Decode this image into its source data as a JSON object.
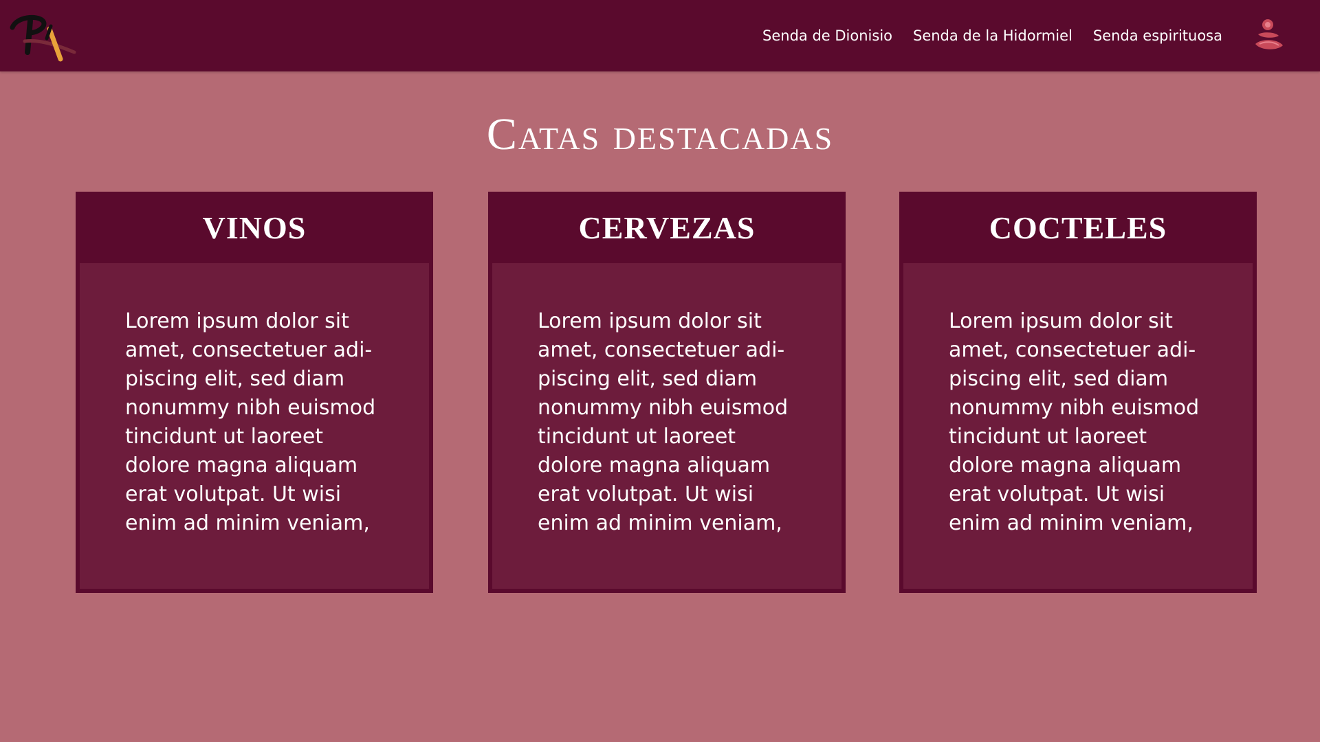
{
  "nav": {
    "links": [
      "Senda de Dionisio",
      "Senda de la Hidormiel",
      "Senda espirituosa"
    ]
  },
  "icons": {
    "logo": "brand-logo",
    "user": "user-icon"
  },
  "main": {
    "title": "Catas destacadas",
    "cards": [
      {
        "title": "VINOS",
        "body": "Lorem ipsum dolor sit amet, consectetuer adi-piscing elit, sed diam nonummy nibh euismod tincidunt ut laoreet dolore magna aliquam erat volutpat. Ut wisi enim ad minim veniam,"
      },
      {
        "title": "CERVEZAS",
        "body": "Lorem ipsum dolor sit amet, consectetuer adi-piscing elit, sed diam nonummy nibh euismod tincidunt ut laoreet dolore magna aliquam erat volutpat. Ut wisi enim ad minim veniam,"
      },
      {
        "title": "COCTELES",
        "body": "Lorem ipsum dolor sit amet, consectetuer adi-piscing elit, sed diam nonummy nibh euismod tincidunt ut laoreet dolore magna aliquam erat volutpat. Ut wisi enim ad minim veniam,"
      }
    ]
  },
  "colors": {
    "background": "#b56a74",
    "navbar": "#5a0a2d",
    "card_header": "#5a0a2d",
    "card_body": "#6d1c3c",
    "text": "#ffffff"
  }
}
